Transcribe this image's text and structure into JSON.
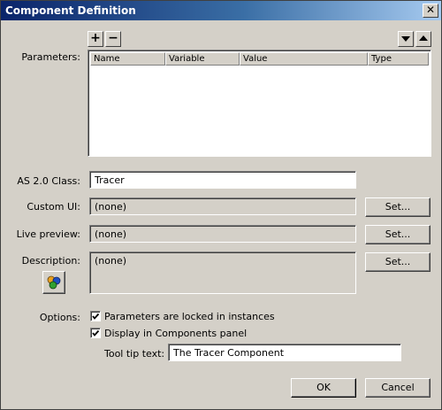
{
  "window": {
    "title": "Component Definition",
    "close_glyph": "✕"
  },
  "parameters": {
    "label": "Parameters:",
    "add_glyph": "+",
    "remove_glyph": "−",
    "columns": [
      "Name",
      "Variable",
      "Value",
      "Type"
    ]
  },
  "as_class": {
    "label": "AS 2.0 Class:",
    "value": "Tracer"
  },
  "custom_ui": {
    "label": "Custom UI:",
    "value": "(none)",
    "button": "Set..."
  },
  "live_preview": {
    "label": "Live preview:",
    "value": "(none)",
    "button": "Set..."
  },
  "description": {
    "label": "Description:",
    "value": "(none)",
    "button": "Set...",
    "icon": "component-icon"
  },
  "options": {
    "label": "Options:",
    "locked": {
      "label": "Parameters are locked in instances",
      "checked": true
    },
    "display": {
      "label": "Display in Components panel",
      "checked": true
    },
    "tooltip_label": "Tool tip text:",
    "tooltip_value": "The Tracer Component"
  },
  "footer": {
    "ok": "OK",
    "cancel": "Cancel"
  }
}
